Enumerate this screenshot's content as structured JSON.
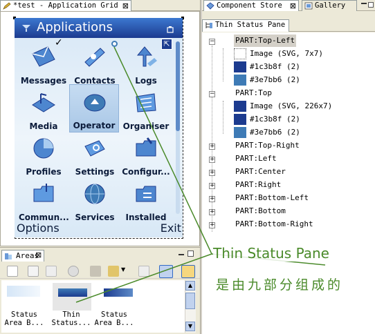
{
  "left_tab": {
    "title": "*test - Application Grid"
  },
  "right_tabs": [
    {
      "label": "Component Store"
    },
    {
      "label": "Gallery"
    }
  ],
  "thin_pane_tab": {
    "label": "Thin Status Pane"
  },
  "phone": {
    "header_title": "Applications",
    "apps": [
      {
        "label": "Messages",
        "icon": "messages-icon"
      },
      {
        "label": "Contacts",
        "icon": "contacts-icon"
      },
      {
        "label": "Logs",
        "icon": "logs-icon"
      },
      {
        "label": "Media",
        "icon": "media-icon"
      },
      {
        "label": "Operator",
        "icon": "operator-icon"
      },
      {
        "label": "Organiser",
        "icon": "organiser-icon"
      },
      {
        "label": "Profiles",
        "icon": "profiles-icon"
      },
      {
        "label": "Settings",
        "icon": "settings-icon"
      },
      {
        "label": "Configur...",
        "icon": "configuration-icon"
      },
      {
        "label": "Commun...",
        "icon": "communication-icon"
      },
      {
        "label": "Services",
        "icon": "services-icon"
      },
      {
        "label": "Installed",
        "icon": "installed-icon"
      }
    ],
    "left_softkey": "Options",
    "right_softkey": "Exit"
  },
  "tree": {
    "part_top_left": "PART:Top-Left",
    "part_top_left_children": [
      "Image (SVG, 7x7)",
      "#1c3b8f (2)",
      "#3e7bb6 (2)"
    ],
    "part_top": "PART:Top",
    "part_top_children": [
      "Image (SVG, 226x7)",
      "#1c3b8f (2)",
      "#3e7bb6 (2)"
    ],
    "collapsed_parts": [
      "PART:Top-Right",
      "PART:Left",
      "PART:Center",
      "PART:Right",
      "PART:Bottom-Left",
      "PART:Bottom",
      "PART:Bottom-Right"
    ]
  },
  "colors": {
    "dark_blue": "#1c3b8f",
    "light_blue": "#3e7bb6",
    "annotation_green": "#4a8a2a"
  },
  "annotation": {
    "line1": "Thin Status Pane",
    "line2": "是由九部分组成的"
  },
  "areas": {
    "title": "Areas",
    "items": [
      {
        "label": "Status\nArea B..."
      },
      {
        "label": "Thin\nStatus..."
      },
      {
        "label": "Status\nArea B..."
      }
    ]
  }
}
